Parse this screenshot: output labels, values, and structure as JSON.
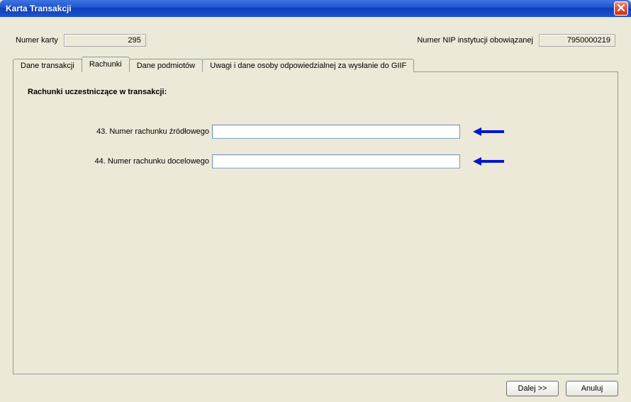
{
  "window": {
    "title": "Karta Transakcji"
  },
  "header": {
    "card_number_label": "Numer karty",
    "card_number_value": "295",
    "nip_label": "Numer NIP instytucji obowiązanej",
    "nip_value": "7950000219"
  },
  "tabs": [
    {
      "label": "Dane transakcji"
    },
    {
      "label": "Rachunki"
    },
    {
      "label": "Dane podmiotów"
    },
    {
      "label": "Uwagi i dane osoby odpowiedzialnej za wysłanie do GIIF"
    }
  ],
  "panel": {
    "section_title": "Rachunki uczestniczące w transakcji:",
    "fields": {
      "source_label": "43. Numer rachunku źródłowego",
      "source_value": "",
      "target_label": "44. Numer rachunku docelowego",
      "target_value": ""
    }
  },
  "buttons": {
    "next": "Dalej >>",
    "cancel": "Anuluj"
  },
  "colors": {
    "arrow": "#0018C8"
  }
}
